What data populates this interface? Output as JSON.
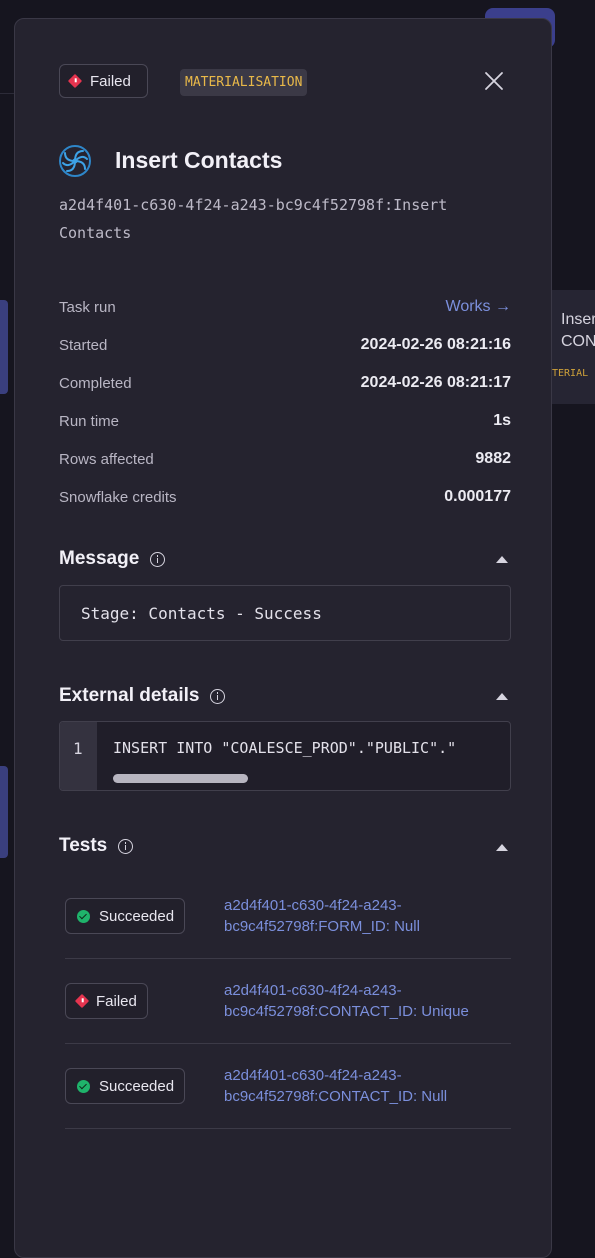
{
  "background": {
    "node_title": "Inser",
    "node_title2": "CON",
    "node_tag": "TERIAL"
  },
  "header": {
    "status": "Failed",
    "node_type_tag": "MATERIALISATION",
    "close_icon": "close-icon"
  },
  "node": {
    "icon": "snowflake-swirl-icon",
    "title": "Insert Contacts",
    "id": "a2d4f401-c630-4f24-a243-bc9c4f52798f:Insert Contacts"
  },
  "details": [
    {
      "label": "Task run",
      "value": "Works →",
      "link": true
    },
    {
      "label": "Started",
      "value": "2024-02-26 08:21:16"
    },
    {
      "label": "Completed",
      "value": "2024-02-26 08:21:17"
    },
    {
      "label": "Run time",
      "value": "1s"
    },
    {
      "label": "Rows affected",
      "value": "9882"
    },
    {
      "label": "Snowflake credits",
      "value": "0.000177"
    }
  ],
  "message": {
    "heading": "Message",
    "text": "Stage: Contacts - Success"
  },
  "external": {
    "heading": "External details",
    "line_number": "1",
    "code": "INSERT INTO \"COALESCE_PROD\".\"PUBLIC\".\""
  },
  "tests": {
    "heading": "Tests",
    "items": [
      {
        "status": "Succeeded",
        "name": "a2d4f401-c630-4f24-a243-bc9c4f52798f:FORM_ID: Null"
      },
      {
        "status": "Failed",
        "name": "a2d4f401-c630-4f24-a243-bc9c4f52798f:CONTACT_ID: Unique"
      },
      {
        "status": "Succeeded",
        "name": "a2d4f401-c630-4f24-a243-bc9c4f52798f:CONTACT_ID: Null"
      }
    ]
  },
  "colors": {
    "accent_link": "#7b8fdc",
    "failed": "#e5344f",
    "succeeded": "#1fb36b",
    "tag_text": "#e9b949"
  }
}
